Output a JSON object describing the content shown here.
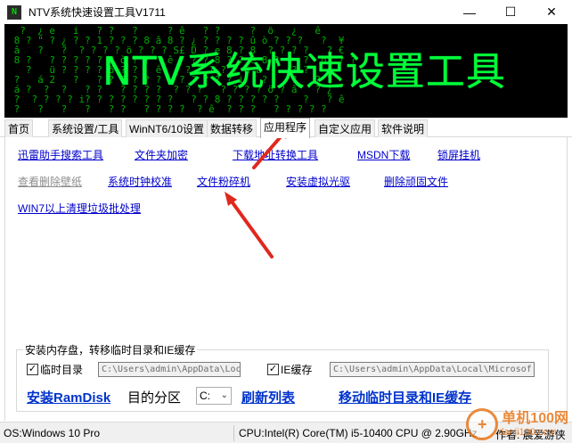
{
  "window": {
    "title": "NTV系统快速设置工具V1711",
    "minimize_glyph": "—",
    "maximize_glyph": "☐",
    "close_glyph": "✕"
  },
  "banner": {
    "title": "NTV系统快速设置工具",
    "matrix_text": "  ?  ¿ e   i   ? ?   ?     ? ê   ? ?     ?  ö   ¿   ê\n 8 ? \" ? ¿ ? ? 1 ? ? ? 8 â 8 ? ¿ ? ? ? ? û ò ? ? ?   ?  ¥\n â   ?   ?  ? ? ? ? ö ? ? ? S£ D ? e 8 ? 8  ? ? ? ?   ? €\n 8 ?   ? ? ? ? ? ? ò ? ?   ê   ? ? 8 ? ? ê 8 ?    ?  ö  ? ?\n   ?   ü ? ? ? ? ö ? ?   ê    ? ? ? ? ? â â     ? ?   ê \n ?   á 2   ?   ? ? ? ? ? ?   ? ? ? ? ? i   ?    ?   ? ?\n á ?  ?  ?   ? ?   ? ? ? ?  ? ? ?   ? ? ? ? ö ? â   ? ¿\n ?  ? ? ? ? i? ? ? ? ? ? ? ?   ? ? 8 ? ? ? ? ?    ?   ? ê\n ?   ?   ?   ?   ? ?   ? ? ? ?  ? ê  ? ? ?   ? ? ? ? ?"
  },
  "tabs": [
    {
      "label": "首页"
    },
    {
      "label": "系统设置/工具"
    },
    {
      "label": "WinNT6/10设置"
    },
    {
      "label": "数据转移"
    },
    {
      "label": "应用程序"
    },
    {
      "label": "自定义应用"
    },
    {
      "label": "软件说明"
    }
  ],
  "active_tab": "应用程序",
  "links": {
    "row1": [
      "迅雷助手搜索工具",
      "文件夹加密",
      "下载地址转换工具",
      "MSDN下载",
      "锁屏挂机"
    ],
    "row2": [
      "查看删除壁纸",
      "系统时钟校准",
      "文件粉碎机",
      "安装虚拟光驱",
      "删除顽固文件"
    ],
    "row3": [
      "WIN7以上清理垃圾批处理"
    ]
  },
  "ramdisk": {
    "group_title": "安装内存盘，转移临时目录和IE缓存",
    "temp_checkbox_label": "临时目录",
    "temp_checked": true,
    "temp_path": "C:\\Users\\admin\\AppData\\Local",
    "ie_checkbox_label": "IE缓存",
    "ie_checked": true,
    "ie_path": "C:\\Users\\admin\\AppData\\Local\\Microsof",
    "install_label": "安装RamDisk",
    "target_label": "目的分区",
    "target_value": "C:",
    "refresh_label": "刷新列表",
    "move_label": "移动临时目录和IE缓存",
    "check_glyph": "✓",
    "dropdown_glyph": "⌄"
  },
  "status": {
    "os": "OS:Windows 10 Pro",
    "cpu": "CPU:Intel(R) Core(TM) i5-10400 CPU @ 2.90GHz",
    "author": "作者: 晨爱游侠"
  },
  "watermark": {
    "logo_glyph": "+",
    "text": "单机100网",
    "sub": "danji100.com"
  },
  "colors": {
    "link": "#0000cc",
    "disabled_link": "#8e8e8e",
    "banner_bg": "#000000",
    "banner_text": "#00ff3a",
    "arrow": "#e0281f"
  }
}
